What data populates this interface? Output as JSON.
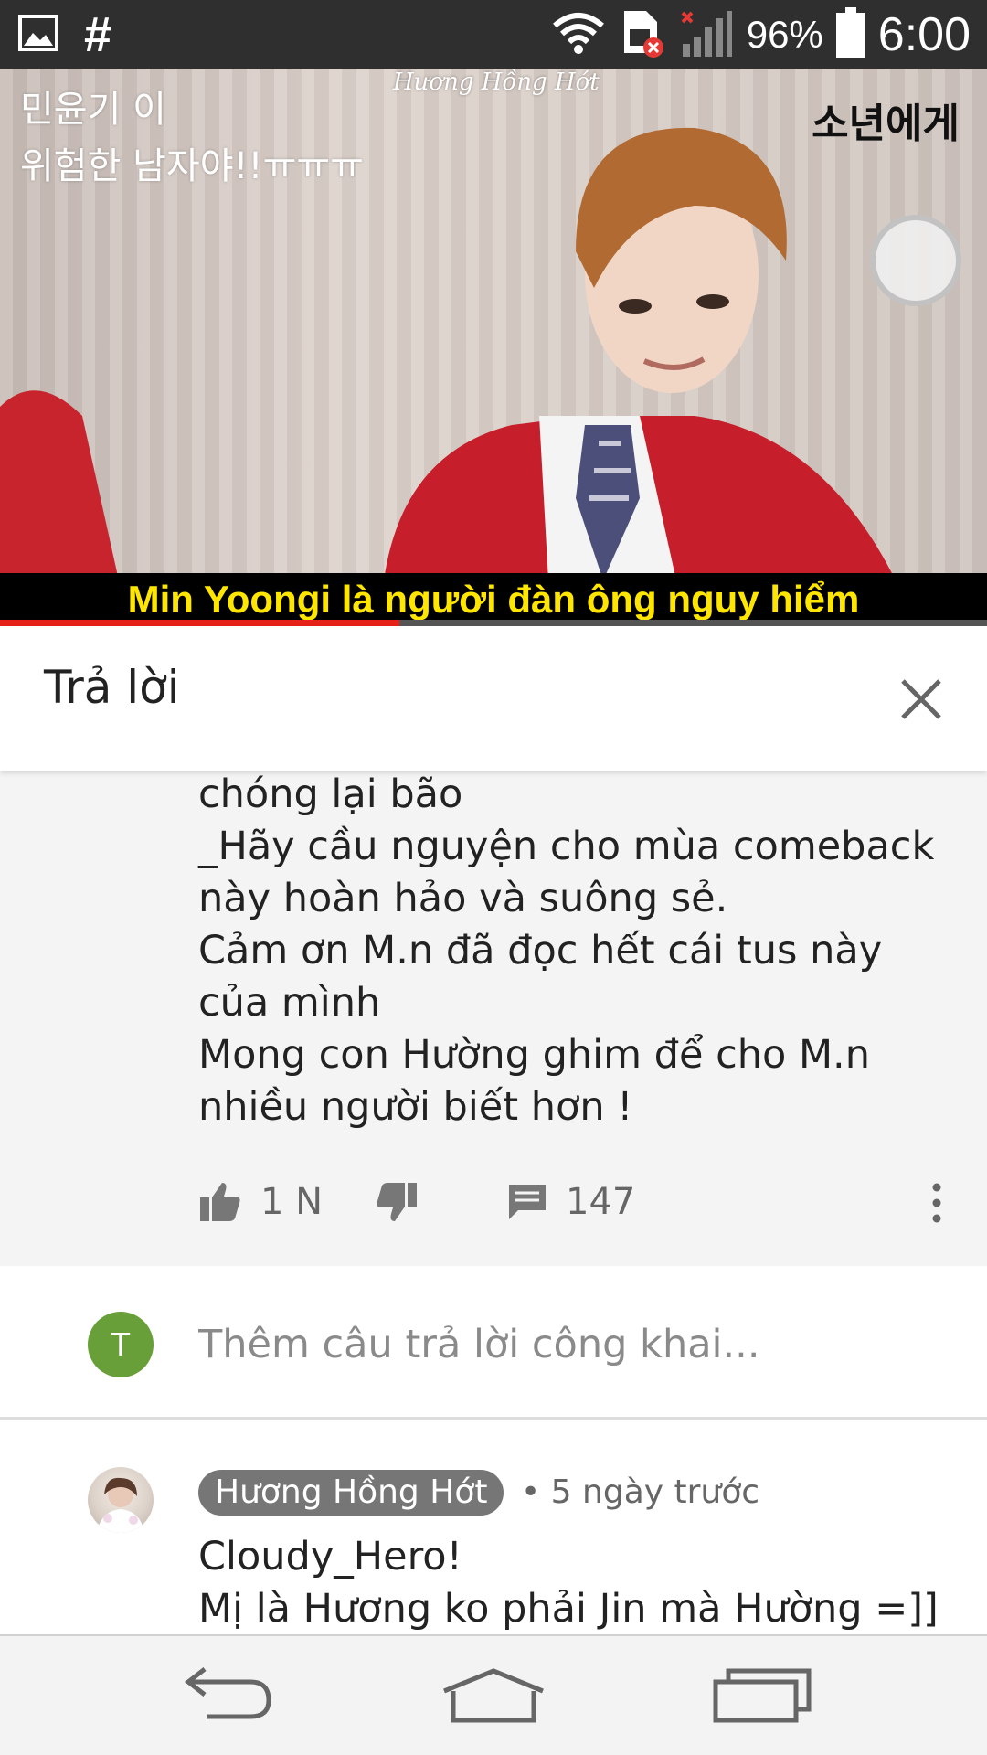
{
  "status_bar": {
    "battery_percent": "96%",
    "time": "6:00",
    "notification_symbol": "#",
    "icons": [
      "image-icon",
      "wifi-icon",
      "sim-error-icon",
      "signal-icon",
      "battery-icon"
    ]
  },
  "video": {
    "overlay_text": "민윤기 이\n위험한 남자야!!ㅠㅠㅠ",
    "watermark": "Hương Hồng Hớt",
    "korean_right": "소년에게",
    "subtitle": "Min Yoongi là người đàn ông nguy hiểm",
    "progress": 0.405
  },
  "reply_panel": {
    "title": "Trả lời",
    "close_icon": "close-icon"
  },
  "comment": {
    "lines": [
      "chóng lại bão",
      "_Hãy cầu nguyện cho mùa comeback",
      "này hoàn hảo và suông sẻ.",
      "Cảm ơn M.n đã đọc hết cái tus này",
      "của mình",
      "Mong con Hường ghim để cho M.n",
      "nhiều người biết hơn !"
    ],
    "likes": "1 N",
    "replies": "147"
  },
  "add_reply": {
    "avatar_letter": "T",
    "avatar_color": "#689f38",
    "placeholder": "Thêm câu trả lời công khai..."
  },
  "next_comment": {
    "author": "Hương Hồng Hớt",
    "meta": "• 5 ngày trước",
    "lines": [
      "Cloudy_Hero!",
      "Mị là Hương ko phải Jin mà Hường =]]"
    ]
  },
  "colors": {
    "progress_red": "#e62117",
    "subtitle_yellow": "#ffe600",
    "status_bar_bg": "#2f2f2f"
  }
}
